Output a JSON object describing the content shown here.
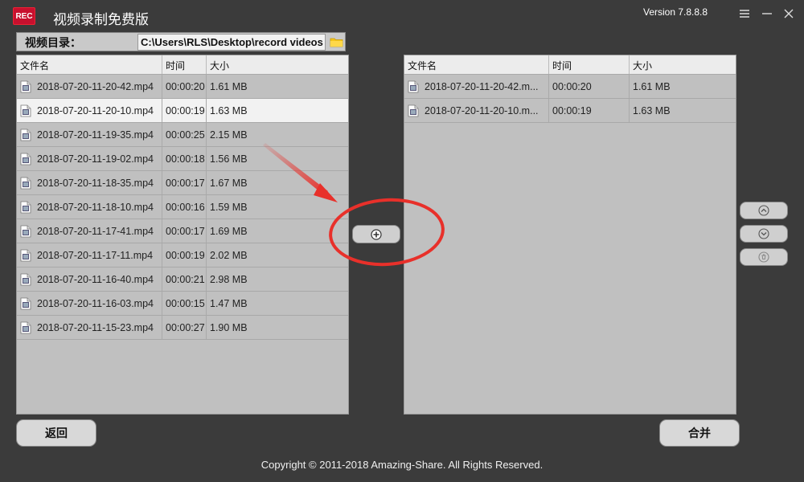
{
  "app": {
    "logo_text": "REC",
    "title": "视频录制免费版",
    "version": "Version 7.8.8.8"
  },
  "directory": {
    "label": "视频目录：",
    "path": "C:\\Users\\RLS\\Desktop\\record videos"
  },
  "left_table": {
    "columns": [
      "文件名",
      "时间",
      "大小"
    ],
    "rows": [
      {
        "name": "2018-07-20-11-20-42.mp4",
        "time": "00:00:20",
        "size": "1.61 MB"
      },
      {
        "name": "2018-07-20-11-20-10.mp4",
        "time": "00:00:19",
        "size": "1.63 MB"
      },
      {
        "name": "2018-07-20-11-19-35.mp4",
        "time": "00:00:25",
        "size": "2.15 MB"
      },
      {
        "name": "2018-07-20-11-19-02.mp4",
        "time": "00:00:18",
        "size": "1.56 MB"
      },
      {
        "name": "2018-07-20-11-18-35.mp4",
        "time": "00:00:17",
        "size": "1.67 MB"
      },
      {
        "name": "2018-07-20-11-18-10.mp4",
        "time": "00:00:16",
        "size": "1.59 MB"
      },
      {
        "name": "2018-07-20-11-17-41.mp4",
        "time": "00:00:17",
        "size": "1.69 MB"
      },
      {
        "name": "2018-07-20-11-17-11.mp4",
        "time": "00:00:19",
        "size": "2.02 MB"
      },
      {
        "name": "2018-07-20-11-16-40.mp4",
        "time": "00:00:21",
        "size": "2.98 MB"
      },
      {
        "name": "2018-07-20-11-16-03.mp4",
        "time": "00:00:15",
        "size": "1.47 MB"
      },
      {
        "name": "2018-07-20-11-15-23.mp4",
        "time": "00:00:27",
        "size": "1.90 MB"
      }
    ]
  },
  "right_table": {
    "columns": [
      "文件名",
      "时间",
      "大小"
    ],
    "rows": [
      {
        "name": "2018-07-20-11-20-42.m...",
        "time": "00:00:20",
        "size": "1.61 MB"
      },
      {
        "name": "2018-07-20-11-20-10.m...",
        "time": "00:00:19",
        "size": "1.63 MB"
      }
    ]
  },
  "buttons": {
    "back": "返回",
    "merge": "合并"
  },
  "footer": {
    "copyright": "Copyright © 2011-2018 Amazing-Share. All Rights Reserved."
  },
  "colors": {
    "background": "#3b3b3b",
    "panel": "#c0c0c0",
    "annotation": "#e8302a",
    "logo": "#c8102e"
  }
}
